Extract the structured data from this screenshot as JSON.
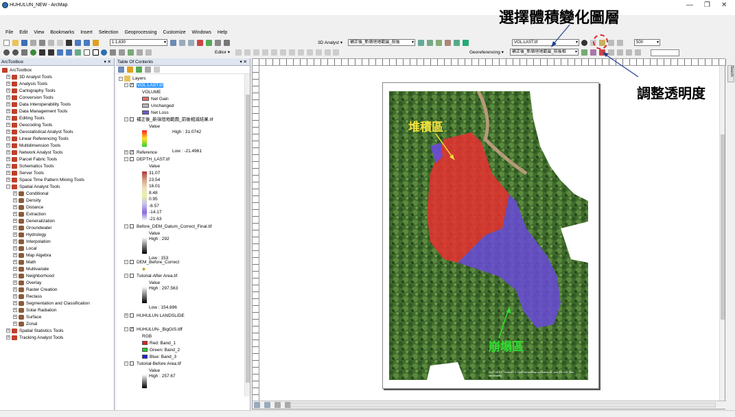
{
  "window": {
    "title": "HUHULUN_NEW - ArcMap",
    "min": "—",
    "max": "❐",
    "close": "✕"
  },
  "menu": [
    "File",
    "Edit",
    "View",
    "Bookmarks",
    "Insert",
    "Selection",
    "Geoprocessing",
    "Customize",
    "Windows",
    "Help"
  ],
  "toolbar": {
    "scale": "1:1,630",
    "analyst3d_label": "3D Analyst ▾",
    "analyst3d_layer": "補正後_新嶺垣地範圍_前後",
    "effects_layer": "VOL.LAST.tif",
    "transparency_value": "500",
    "editor_label": "Editor ▾",
    "georef_label": "Georeferencing ▾",
    "georef_layer": "補正後_新嶺垣地範圍_前後相"
  },
  "arctoolbox": {
    "title": "ArcToolbox",
    "root": "ArcToolbox",
    "toolsets": [
      "3D Analyst Tools",
      "Analysis Tools",
      "Cartography Tools",
      "Conversion Tools",
      "Data Interoperability Tools",
      "Data Management Tools",
      "Editing Tools",
      "Geocoding Tools",
      "Geostatistical Analyst Tools",
      "Linear Referencing Tools",
      "Multidimension Tools",
      "Network Analyst Tools",
      "Parcel Fabric Tools",
      "Schematics Tools",
      "Server Tools",
      "Space Time Pattern Mining Tools",
      "Spatial Analyst Tools"
    ],
    "spatial_children": [
      "Conditional",
      "Density",
      "Distance",
      "Extraction",
      "Generalization",
      "Groundwater",
      "Hydrology",
      "Interpolation",
      "Local",
      "Map Algebra",
      "Math",
      "Multivariate",
      "Neighborhood",
      "Overlay",
      "Raster Creation",
      "Reclass",
      "Segmentation and Classification",
      "Solar Radiation",
      "Surface",
      "Zonal"
    ],
    "after": [
      "Spatial Statistics Tools",
      "Tracking Analyst Tools"
    ]
  },
  "toc": {
    "title": "Table Of Contents",
    "layers_label": "Layers",
    "vol_layer": "VOL.LAST.tif",
    "vol_field": "VOLUME",
    "vol_classes": [
      {
        "label": "Net Gain",
        "color": "#e26a6a"
      },
      {
        "label": "Unchanged",
        "color": "#b8b8b8"
      },
      {
        "label": "Net Loss",
        "color": "#6a5acd"
      }
    ],
    "diff_layer": "補正後_新嶺垣地範圍_前後相減結果.tif",
    "diff_value": "Value",
    "diff_high": "High : 31.0742",
    "diff_low": "Low : -21.4961",
    "reference": "Reference",
    "depth_layer": "DEPTH_LAST.tif",
    "depth_value": "Value",
    "depth_ticks": [
      "31.07",
      "23.54",
      "16.01",
      "8.48",
      "0.95",
      "-6.57",
      "-14.17",
      "-21.63"
    ],
    "before_dem": "Before_DEM_Datum_Correct_Final.tif",
    "before_value": "Value",
    "before_high": "High : 292",
    "before_low": "Low : 153",
    "dem_before": "DEM_Before_Correct",
    "tut_after": "Tutorial-After Area.tif",
    "tut_after_value": "Value",
    "tut_after_high": "High : 297.563",
    "tut_after_low": "Low : 154.896",
    "landslide": "HUHULUN LANDSLIDE",
    "biggis": "HUHULUN-_BigGIS.tiff",
    "rgb": "RGB",
    "red": "Red:   Band_1",
    "green": "Green: Band_2",
    "blue": "Blue:  Band_3",
    "tut_before": "Tutorial-Before Area.tif",
    "tut_before_value": "Value",
    "tut_before_high": "High : 257.67"
  },
  "map": {
    "label_deposit": "堆積區",
    "label_collapse": "崩塌區",
    "credits": "Esri, HERE, Garmin, © OpenStreetMap contributors, and the GIS user community",
    "search_tab": "Search"
  },
  "annotations": {
    "select_layer": "選擇體積變化圖層",
    "adjust_transparency": "調整透明度"
  }
}
